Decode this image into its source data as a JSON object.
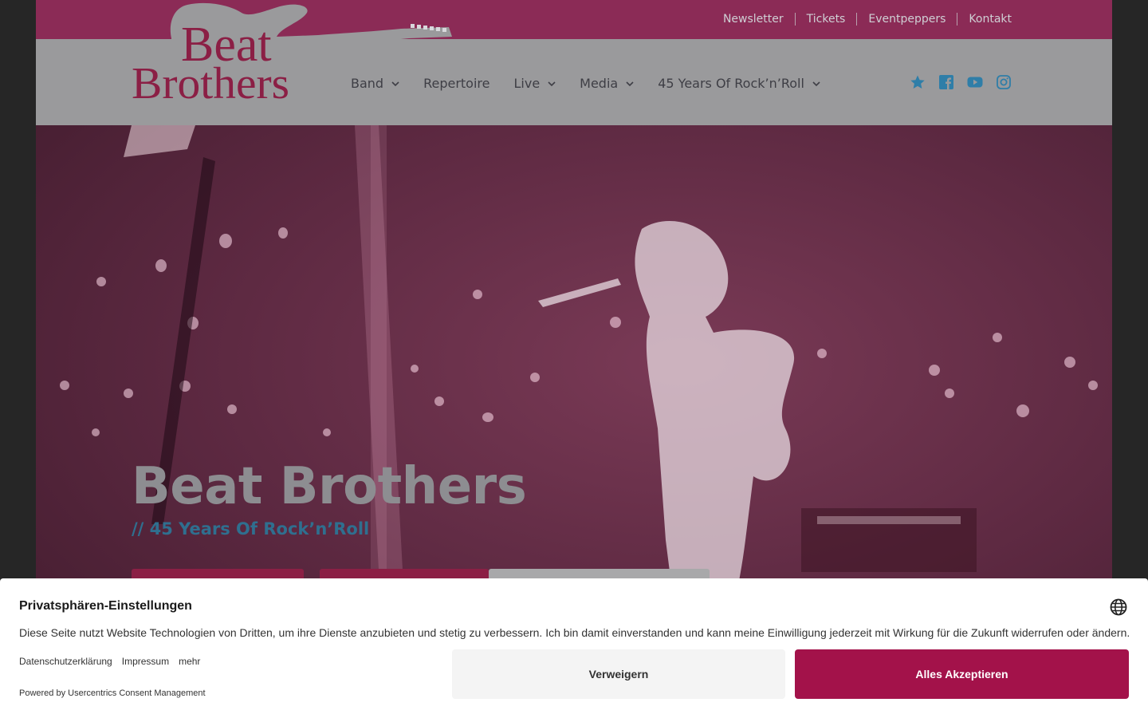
{
  "topnav": {
    "items": [
      "Newsletter",
      "Tickets",
      "Eventpeppers",
      "Kontakt"
    ]
  },
  "logo": {
    "line1": "Beat",
    "line2": "Brothers"
  },
  "mainnav": {
    "items": [
      {
        "label": "Band",
        "has_dropdown": true
      },
      {
        "label": "Repertoire",
        "has_dropdown": false
      },
      {
        "label": "Live",
        "has_dropdown": true
      },
      {
        "label": "Media",
        "has_dropdown": true
      },
      {
        "label": "45 Years Of Rock’n’Roll",
        "has_dropdown": true
      }
    ]
  },
  "social": {
    "icons": [
      "star-icon",
      "facebook-icon",
      "youtube-icon",
      "instagram-icon"
    ],
    "color": "#2f7ea8"
  },
  "hero": {
    "title": "Beat Brothers",
    "subtitle": "// 45 Years Of Rock’n’Roll"
  },
  "consent": {
    "title": "Privatsphären-Einstellungen",
    "description": "Diese Seite nutzt Website Technologien von Dritten, um ihre Dienste anzubieten und stetig zu verbessern. Ich bin damit einverstanden und kann meine Einwilligung jederzeit mit Wirkung für die Zukunft widerrufen oder ändern.",
    "links": [
      "Datenschutzerklärung",
      "Impressum",
      "mehr"
    ],
    "powered_by": "Powered by Usercentrics Consent Management",
    "deny_label": "Verweigern",
    "accept_label": "Alles Akzeptieren",
    "accent_color": "#a3124a"
  },
  "colors": {
    "topbar": "#8b2b56",
    "header": "#9a9a9c",
    "overlay": "#5a2b3f"
  }
}
